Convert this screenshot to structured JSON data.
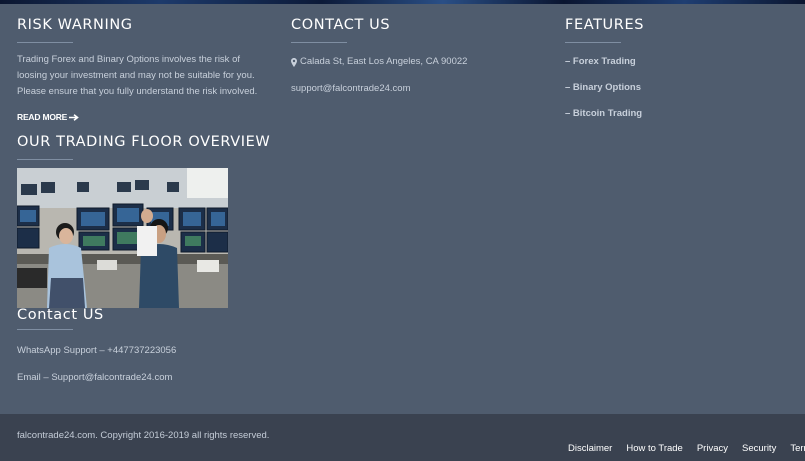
{
  "risk": {
    "title": "RISK WARNING",
    "text": "Trading Forex and Binary Options involves the risk of loosing your investment and may not be suitable for you. Please ensure that you fully understand the risk involved.",
    "read_more": "READ MORE"
  },
  "trading_floor": {
    "title": "OUR TRADING FLOOR OVERVIEW"
  },
  "contact_us_block": {
    "title": "Contact US",
    "whatsapp": "WhatsApp Support – +447737223056",
    "email": "Email – Support@falcontrade24.com"
  },
  "contact": {
    "title": "CONTACT US",
    "address": "Calada St, East Los Angeles, CA 90022",
    "email": "support@falcontrade24.com"
  },
  "features": {
    "title": "FEATURES",
    "items": [
      "– Forex Trading",
      "– Binary Options",
      "– Bitcoin Trading"
    ]
  },
  "footer": {
    "copyright": "falcontrade24.com. Copyright 2016-2019 all rights reserved.",
    "links": [
      "Disclaimer",
      "How to Trade",
      "Privacy",
      "Security",
      "Terms"
    ]
  },
  "colors": {
    "background": "#4f5c6e",
    "footer": "#3a4250",
    "heading": "#ffffff",
    "body_text": "#c8d0db"
  }
}
